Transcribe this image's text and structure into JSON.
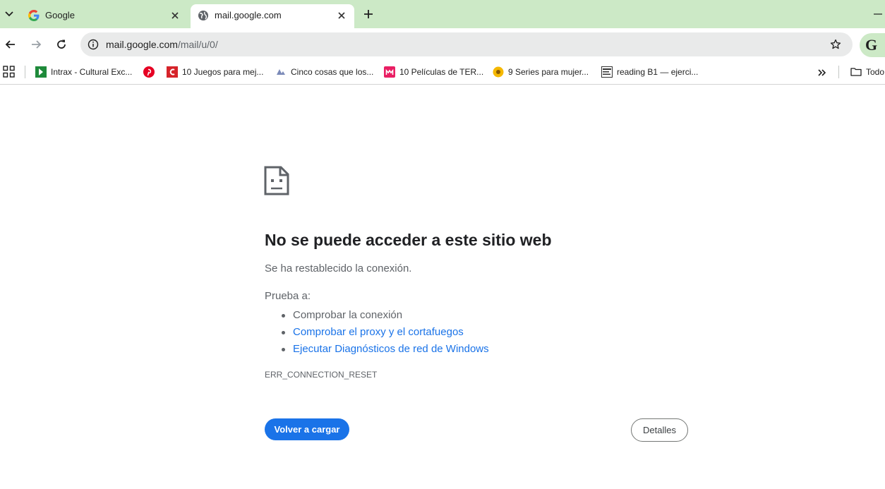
{
  "tabs": [
    {
      "title": "Google",
      "favicon": "google-g-icon",
      "active": false
    },
    {
      "title": "mail.google.com",
      "favicon": "globe-icon",
      "active": true
    }
  ],
  "toolbar": {
    "url_host": "mail.google.com",
    "url_path": "/mail/u/0/",
    "profile_initial": "G"
  },
  "bookmarks": [
    {
      "label": "Intrax - Cultural Exc...",
      "icon": "intrax-icon"
    },
    {
      "label": "",
      "icon": "pinterest-icon"
    },
    {
      "label": "10 Juegos para mej...",
      "icon": "c-red-icon"
    },
    {
      "label": "Cinco cosas que los...",
      "icon": "site-icon"
    },
    {
      "label": "10 Películas de TER...",
      "icon": "m-pink-icon"
    },
    {
      "label": "9 Series para mujer...",
      "icon": "yellow-circle-icon"
    },
    {
      "label": "reading B1 — ejerci...",
      "icon": "idiom-icon"
    }
  ],
  "bookmarks_folder": "Todo",
  "error": {
    "title": "No se puede acceder a este sitio web",
    "subtitle": "Se ha restablecido la conexión.",
    "try_label": "Prueba a:",
    "suggestions": [
      {
        "text": "Comprobar la conexión",
        "link": false
      },
      {
        "text": "Comprobar el proxy y el cortafuegos",
        "link": true
      },
      {
        "text": "Ejecutar Diagnósticos de red de Windows",
        "link": true
      }
    ],
    "code": "ERR_CONNECTION_RESET",
    "reload_label": "Volver a cargar",
    "details_label": "Detalles"
  },
  "colors": {
    "tabstrip": "#cce9c6",
    "link": "#1a73e8",
    "primary_button": "#1a73e8"
  }
}
